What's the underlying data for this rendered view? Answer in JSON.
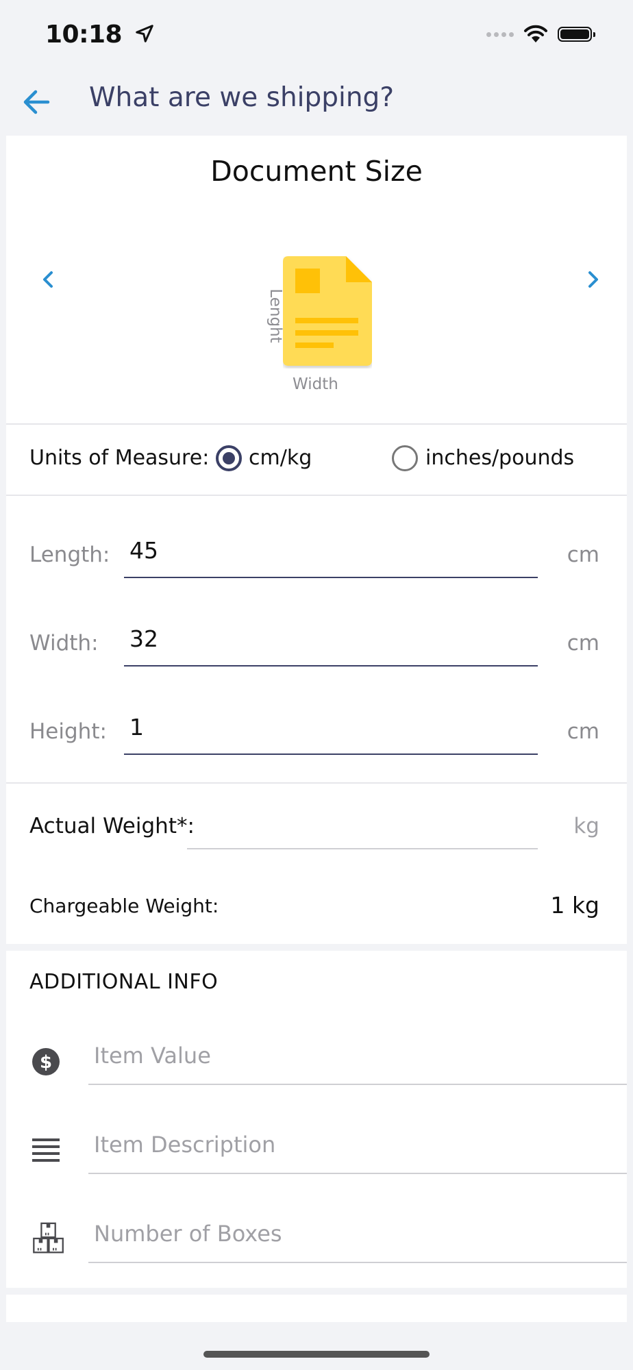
{
  "status_bar": {
    "time": "10:18"
  },
  "header": {
    "title": "What are we shipping?"
  },
  "document": {
    "title": "Document Size",
    "icon_length_label": "Lenght",
    "icon_width_label": "Width"
  },
  "units": {
    "label": "Units of Measure:",
    "options": [
      {
        "label": "cm/kg",
        "selected": true
      },
      {
        "label": "inches/pounds",
        "selected": false
      }
    ]
  },
  "dimensions": [
    {
      "label": "Length:",
      "value": "45",
      "unit": "cm"
    },
    {
      "label": "Width:",
      "value": "32",
      "unit": "cm"
    },
    {
      "label": "Height:",
      "value": "1",
      "unit": "cm"
    }
  ],
  "actual_weight": {
    "label": "Actual Weight*:",
    "value": "",
    "unit": "kg"
  },
  "chargeable_weight": {
    "label": "Chargeable Weight:",
    "value": "1 kg"
  },
  "additional_info": {
    "title": "ADDITIONAL INFO",
    "fields": [
      {
        "icon": "dollar-icon",
        "placeholder": "Item Value"
      },
      {
        "icon": "lines-icon",
        "placeholder": "Item Description"
      },
      {
        "icon": "boxes-icon",
        "placeholder": "Number of Boxes"
      }
    ]
  },
  "colors": {
    "accent": "#2a8fd0",
    "primary": "#3b4066",
    "document_yellow": "#ffdb55",
    "document_dark_yellow": "#ffc107"
  }
}
